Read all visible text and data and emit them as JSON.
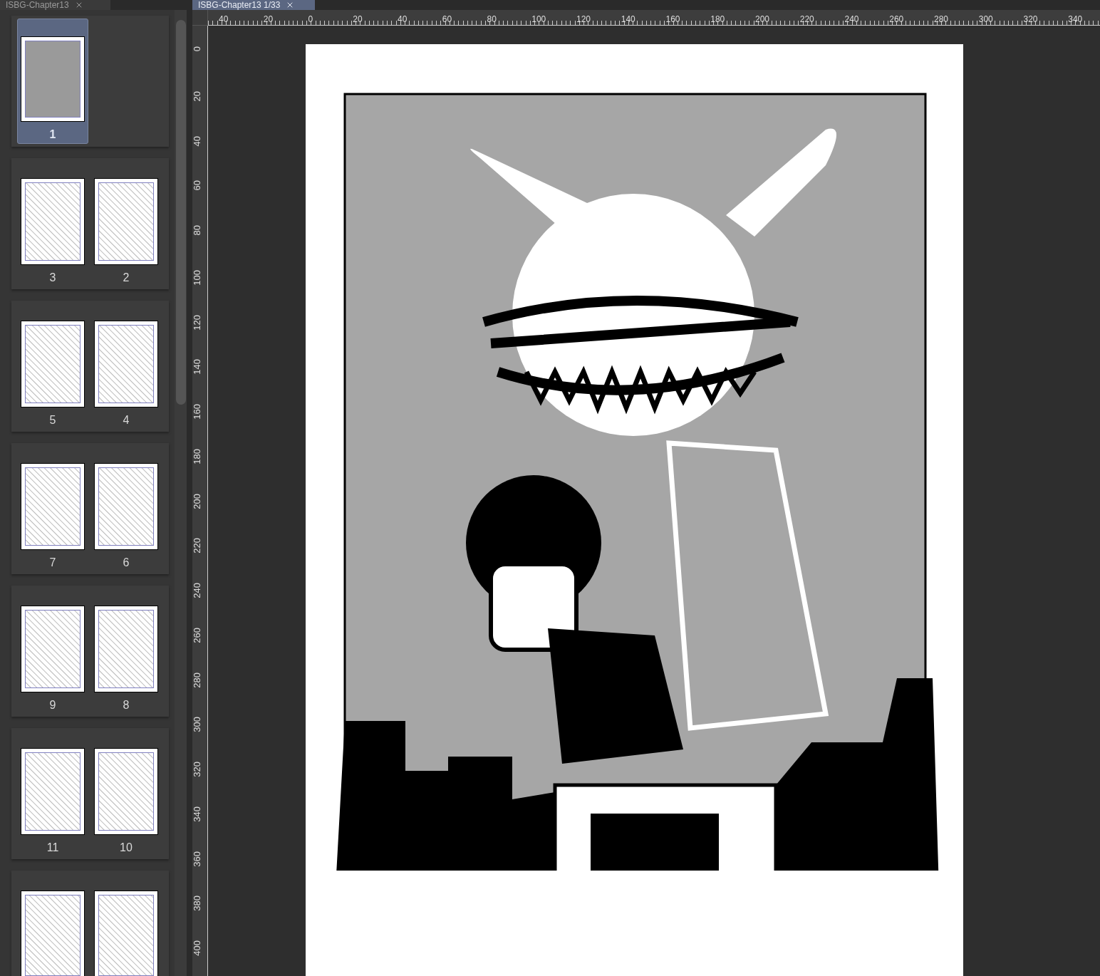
{
  "document_tabs": [
    {
      "label": "ISBG-Chapter13",
      "selected": false
    },
    {
      "label": "ISBG-Chapter13 1/33",
      "selected": true
    }
  ],
  "page_spreads": [
    {
      "pages": [
        {
          "number": "1",
          "selected": true
        }
      ]
    },
    {
      "pages": [
        {
          "number": "3",
          "selected": false
        },
        {
          "number": "2",
          "selected": false
        }
      ]
    },
    {
      "pages": [
        {
          "number": "5",
          "selected": false
        },
        {
          "number": "4",
          "selected": false
        }
      ]
    },
    {
      "pages": [
        {
          "number": "7",
          "selected": false
        },
        {
          "number": "6",
          "selected": false
        }
      ]
    },
    {
      "pages": [
        {
          "number": "9",
          "selected": false
        },
        {
          "number": "8",
          "selected": false
        }
      ]
    },
    {
      "pages": [
        {
          "number": "11",
          "selected": false
        },
        {
          "number": "10",
          "selected": false
        }
      ]
    },
    {
      "pages": [
        {
          "selected": false
        },
        {
          "selected": false
        }
      ]
    }
  ],
  "ruler_top": {
    "labels": [
      "40",
      "20",
      "0",
      "20",
      "40",
      "60",
      "80",
      "100",
      "120",
      "140",
      "160",
      "180",
      "200",
      "220",
      "240",
      "260",
      "280",
      "300",
      "320",
      "340"
    ]
  },
  "ruler_left": {
    "labels": [
      "0",
      "20",
      "40",
      "60",
      "80",
      "100",
      "120",
      "140",
      "160",
      "180",
      "200",
      "220",
      "240",
      "260",
      "280",
      "300",
      "320",
      "340",
      "360",
      "380",
      "400"
    ]
  }
}
